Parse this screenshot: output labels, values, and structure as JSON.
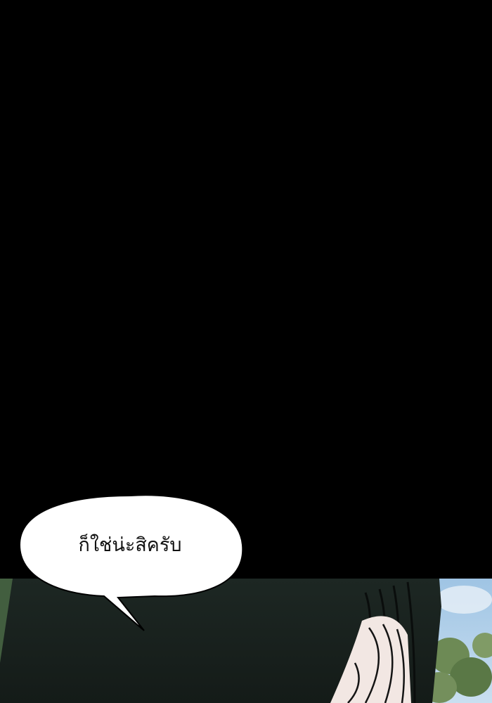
{
  "speech_bubble": {
    "text": "ก็ใช่น่ะสิครับ"
  },
  "colors": {
    "background": "#000000",
    "bubble_fill": "#ffffff",
    "sky": "#8fb8d8",
    "foliage": "#5d7a4a"
  }
}
